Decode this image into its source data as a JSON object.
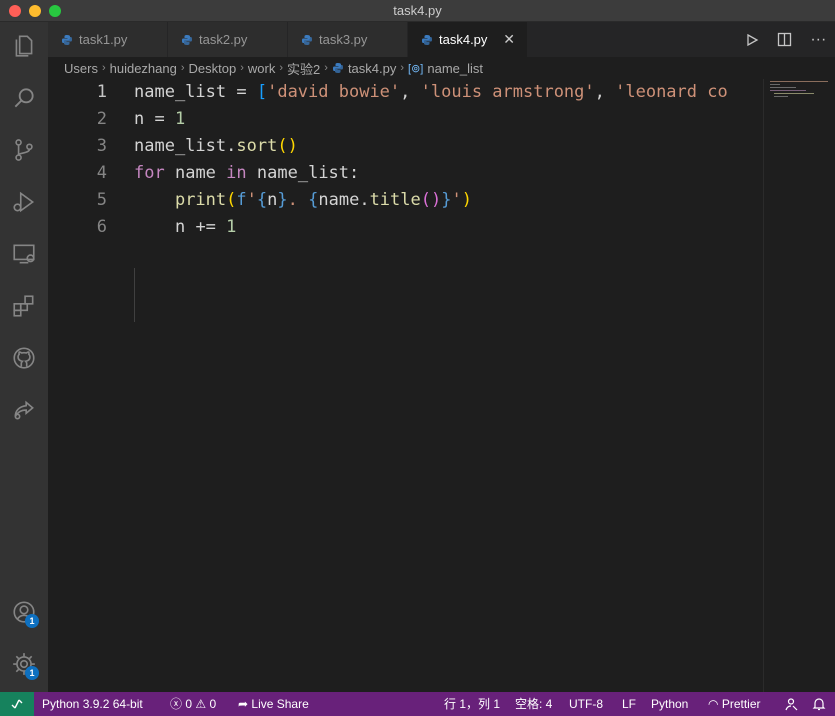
{
  "window": {
    "title": "task4.py"
  },
  "tabs": [
    {
      "label": "task1.py"
    },
    {
      "label": "task2.py"
    },
    {
      "label": "task3.py"
    },
    {
      "label": "task4.py",
      "active": true
    }
  ],
  "breadcrumb": [
    "Users",
    "huidezhang",
    "Desktop",
    "work",
    "实验2",
    "task4.py",
    "name_list"
  ],
  "editor": {
    "current_line": 1,
    "lines": [
      {
        "no": "1",
        "text": "name_list = ['david bowie', 'louis armstrong', 'leonard co"
      },
      {
        "no": "2",
        "text": "n = 1"
      },
      {
        "no": "3",
        "text": "name_list.sort()"
      },
      {
        "no": "4",
        "text": "for name in name_list:"
      },
      {
        "no": "5",
        "text": "    print(f'{n}. {name.title()}')"
      },
      {
        "no": "6",
        "text": "    n += 1"
      }
    ]
  },
  "activity_bar": {
    "icons": [
      "files-icon",
      "search-icon",
      "source-control-icon",
      "run-debug-icon",
      "remote-explorer-icon",
      "extensions-icon",
      "github-icon",
      "live-share-icon"
    ],
    "accounts_badge": "1",
    "settings_badge": "1"
  },
  "statusbar": {
    "python": "Python 3.9.2 64-bit",
    "errors": "0",
    "warnings": "0",
    "live_share": "Live Share",
    "position": "行 1，列 1",
    "spaces": "空格: 4",
    "encoding": "UTF-8",
    "eol": "LF",
    "language": "Python",
    "prettier": "Prettier"
  },
  "colors": {
    "statusbar": "#68217a",
    "remote": "#16825d",
    "keyword": "#c586c0",
    "string": "#ce9178",
    "number": "#b5cea8",
    "function": "#dcdcaa",
    "bracket": "#ffd700"
  }
}
